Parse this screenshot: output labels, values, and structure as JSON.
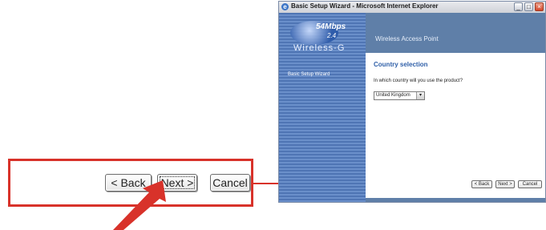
{
  "callout": {
    "back_label": "< Back",
    "next_label": "Next >",
    "cancel_label": "Cancel"
  },
  "window": {
    "title": "Basic Setup Wizard - Microsoft Internet Explorer",
    "minimize": "_",
    "maximize": "□",
    "close": "×",
    "logo": {
      "speed": "54Mbps",
      "band": "2.4",
      "brand": "Wireless-G"
    },
    "sidebar_link": "Basic Setup Wizard",
    "header": "Wireless Access Point",
    "section_title": "Country selection",
    "question": "In which country will you use the product?",
    "country_select": {
      "selected": "United Kingdom"
    },
    "buttons": {
      "back": "< Back",
      "next": "Next >",
      "cancel": "Cancel"
    }
  },
  "colors": {
    "accent_red": "#d8322a",
    "header_blue": "#5f7fa8",
    "title_blue": "#2f5fa8"
  }
}
